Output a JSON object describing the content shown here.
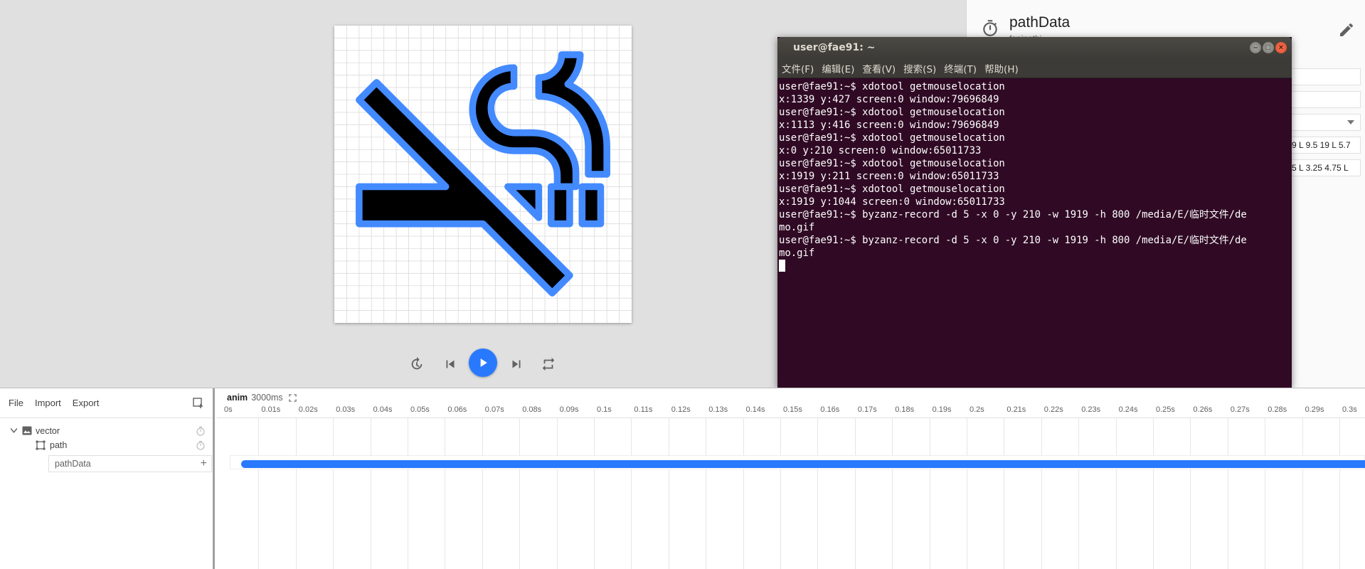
{
  "canvas": {
    "artboard_bg": "#ffffff",
    "icon_fill": "#000000",
    "icon_stroke": "#448aff",
    "grid_color": "#dcdcdc"
  },
  "playback": {
    "controls": [
      "reset-icon",
      "skip-previous-icon",
      "play-icon",
      "skip-next-icon",
      "repeat-icon"
    ],
    "accent": "#2979ff"
  },
  "properties": {
    "title": "pathData",
    "subtitle": "fapinathi",
    "field_1": "",
    "field_2": "",
    "field_3": "",
    "field_4": "9 L 9.5 19 L 5.7",
    "field_5": "5 L 3.25 4.75 L"
  },
  "terminal": {
    "title": "user@fae91: ~",
    "menu": [
      "文件(F)",
      "编辑(E)",
      "查看(V)",
      "搜索(S)",
      "终端(T)",
      "帮助(H)"
    ],
    "lines": [
      "user@fae91:~$ xdotool getmouselocation",
      "x:1339 y:427 screen:0 window:79696849",
      "user@fae91:~$ xdotool getmouselocation",
      "x:1113 y:416 screen:0 window:79696849",
      "user@fae91:~$ xdotool getmouselocation",
      "x:0 y:210 screen:0 window:65011733",
      "user@fae91:~$ xdotool getmouselocation",
      "x:1919 y:211 screen:0 window:65011733",
      "user@fae91:~$ xdotool getmouselocation",
      "x:1919 y:1044 screen:0 window:65011733",
      "user@fae91:~$ byzanz-record -d 5 -x 0 -y 210 -w 1919 -h 800 /media/E/临时文件/de",
      "mo.gif",
      "user@fae91:~$ byzanz-record -d 5 -x 0 -y 210 -w 1919 -h 800 /media/E/临时文件/de",
      "mo.gif"
    ],
    "bg": "#300a24"
  },
  "layers": {
    "toolbar": {
      "file": "File",
      "import": "Import",
      "export": "Export"
    },
    "tree": [
      {
        "name": "vector",
        "icon": "image-icon"
      },
      {
        "name": "path",
        "icon": "path-icon"
      }
    ],
    "property_row": "pathData",
    "property_add": "+"
  },
  "timeline": {
    "anim_name": "anim",
    "anim_duration": "3000ms",
    "ticks": [
      "0s",
      "0.01s",
      "0.02s",
      "0.03s",
      "0.04s",
      "0.05s",
      "0.06s",
      "0.07s",
      "0.08s",
      "0.09s",
      "0.1s",
      "0.11s",
      "0.12s",
      "0.13s",
      "0.14s",
      "0.15s",
      "0.16s",
      "0.17s",
      "0.18s",
      "0.19s",
      "0.2s",
      "0.21s",
      "0.22s",
      "0.23s",
      "0.24s",
      "0.25s",
      "0.26s",
      "0.27s",
      "0.28s",
      "0.29s",
      "0.3s"
    ],
    "block_color": "#2979ff"
  }
}
